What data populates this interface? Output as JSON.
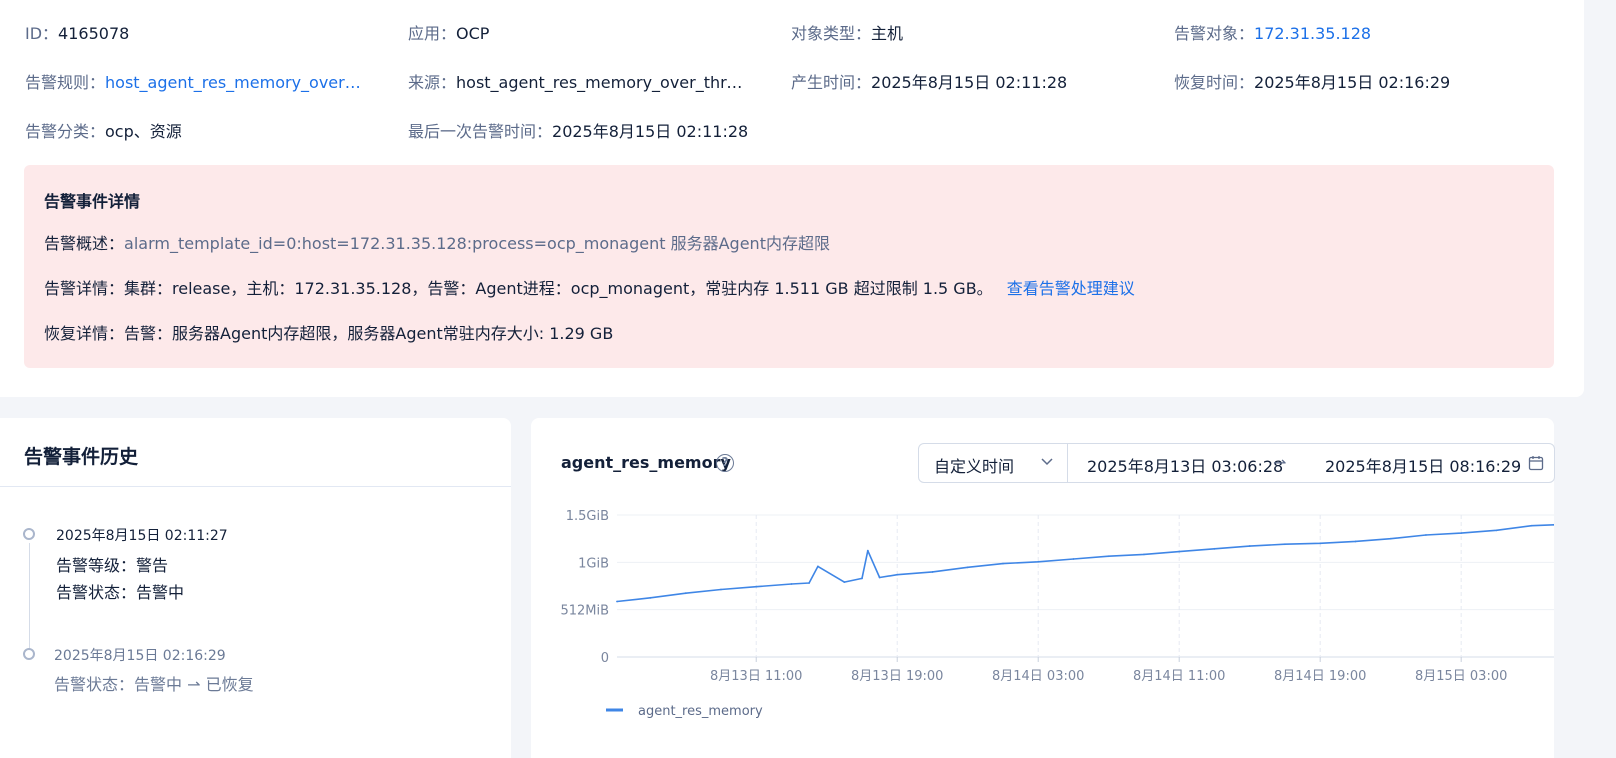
{
  "info": {
    "id": {
      "label": "ID：",
      "value": "4165078"
    },
    "app": {
      "label": "应用：",
      "value": "OCP"
    },
    "object_type": {
      "label": "对象类型：",
      "value": "主机"
    },
    "alarm_target": {
      "label": "告警对象：",
      "value": "172.31.35.128"
    },
    "rule": {
      "label": "告警规则：",
      "value": "host_agent_res_memory_over_t..."
    },
    "source": {
      "label": "来源：",
      "value": "host_agent_res_memory_over_thres..."
    },
    "created_at": {
      "label": "产生时间：",
      "value": "2025年8月15日 02:11:28"
    },
    "recovered_at": {
      "label": "恢复时间：",
      "value": "2025年8月15日 02:16:29"
    },
    "category": {
      "label": "告警分类：",
      "value": "ocp、资源"
    },
    "last_alarm": {
      "label": "最后一次告警时间：",
      "value": "2025年8月15日 02:11:28"
    }
  },
  "details": {
    "title": "告警事件详情",
    "summary_label": "告警概述：",
    "summary_value": "alarm_template_id=0:host=172.31.35.128:process=ocp_monagent 服务器Agent内存超限",
    "detail_label": "告警详情：",
    "detail_value": "集群：release，主机：172.31.35.128，告警：Agent进程：ocp_monagent，常驻内存 1.511 GB 超过限制 1.5 GB。",
    "detail_link": "查看告警处理建议",
    "recovery_label": "恢复详情：",
    "recovery_value": "告警：服务器Agent内存超限，服务器Agent常驻内存大小: 1.29 GB"
  },
  "history": {
    "title": "告警事件历史",
    "events": [
      {
        "time": "2025年8月15日 02:11:27",
        "level": "告警等级：警告",
        "status": "告警状态：告警中"
      },
      {
        "time": "2025年8月15日 02:16:29",
        "status": "告警状态：告警中 ⇀ 已恢复"
      }
    ]
  },
  "chart_panel": {
    "metric_name": "agent_res_memory",
    "help_icon": "question-circle-icon",
    "range_mode": "自定义时间",
    "range_start": "2025年8月13日 03:06:28",
    "range_arrow": "⇀",
    "range_end": "2025年8月15日 08:16:29",
    "calendar_icon": "calendar-icon"
  },
  "colors": {
    "accent": "#1c70e8",
    "alert_bg": "#fde9ea",
    "line": "#3f86e6"
  },
  "chart_data": {
    "type": "line",
    "x_unit": "hours",
    "x_ticks": [
      {
        "label": "8月13日 11:00",
        "value": "2025-08-13 11:00"
      },
      {
        "label": "8月13日 19:00",
        "value": "2025-08-13 19:00"
      },
      {
        "label": "8月14日 03:00",
        "value": "2025-08-14 03:00"
      },
      {
        "label": "8月14日 11:00",
        "value": "2025-08-14 11:00"
      },
      {
        "label": "8月14日 19:00",
        "value": "2025-08-14 19:00"
      },
      {
        "label": "8月15日 03:00",
        "value": "2025-08-15 03:00"
      }
    ],
    "xlim": [
      "2025-08-13 03:06",
      "2025-08-15 08:16"
    ],
    "y_ticks": [
      {
        "label": "1.5GiB",
        "value": 1536
      },
      {
        "label": "1GiB",
        "value": 1024
      },
      {
        "label": "512MiB",
        "value": 512
      },
      {
        "label": "0",
        "value": 0
      }
    ],
    "ylim": [
      0,
      1536
    ],
    "y_unit": "MiB",
    "grid": true,
    "legend_position": "bottom-left",
    "series": [
      {
        "name": "agent_res_memory",
        "x": [
          "2025-08-13 03:06",
          "2025-08-13 05:00",
          "2025-08-13 07:00",
          "2025-08-13 09:00",
          "2025-08-13 11:00",
          "2025-08-13 13:00",
          "2025-08-13 14:00",
          "2025-08-13 14:30",
          "2025-08-13 16:00",
          "2025-08-13 17:00",
          "2025-08-13 17:20",
          "2025-08-13 18:00",
          "2025-08-13 19:00",
          "2025-08-13 21:00",
          "2025-08-13 23:00",
          "2025-08-14 01:00",
          "2025-08-14 03:00",
          "2025-08-14 05:00",
          "2025-08-14 07:00",
          "2025-08-14 09:00",
          "2025-08-14 11:00",
          "2025-08-14 13:00",
          "2025-08-14 15:00",
          "2025-08-14 17:00",
          "2025-08-14 19:00",
          "2025-08-14 21:00",
          "2025-08-14 23:00",
          "2025-08-15 01:00",
          "2025-08-15 03:00",
          "2025-08-15 05:00",
          "2025-08-15 07:00",
          "2025-08-15 08:16"
        ],
        "values": [
          600,
          640,
          690,
          730,
          760,
          790,
          800,
          980,
          810,
          850,
          1150,
          860,
          890,
          920,
          970,
          1010,
          1030,
          1060,
          1090,
          1110,
          1140,
          1170,
          1200,
          1220,
          1230,
          1250,
          1280,
          1320,
          1340,
          1370,
          1420,
          1430
        ]
      }
    ]
  }
}
